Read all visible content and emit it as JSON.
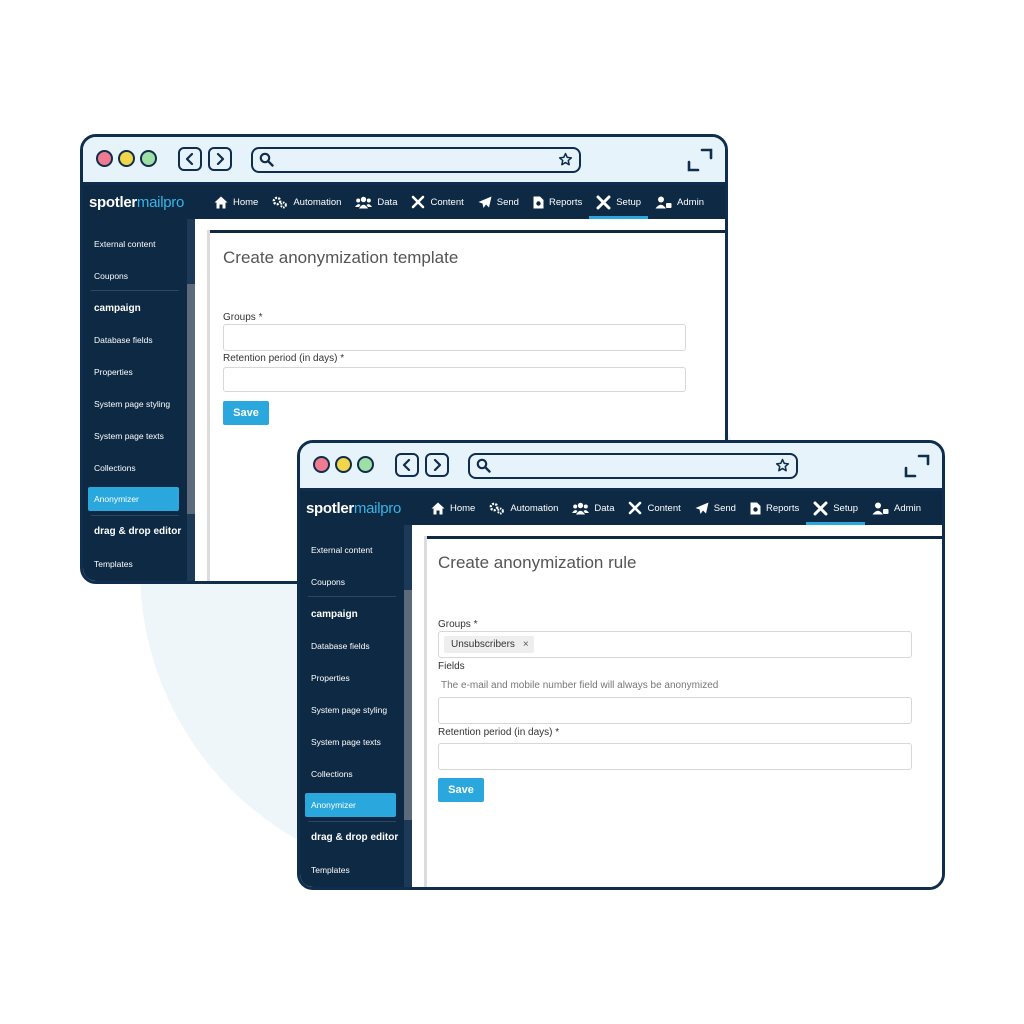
{
  "brand": {
    "name_main": "spotler",
    "name_accent": "mailpro",
    "accent_color": "#2aa8dd",
    "nav_bg": "#0d2944"
  },
  "nav": {
    "home": "Home",
    "automation": "Automation",
    "data": "Data",
    "content": "Content",
    "send": "Send",
    "reports": "Reports",
    "setup": "Setup",
    "admin": "Admin"
  },
  "sidebar": {
    "external_content": "External content",
    "coupons": "Coupons",
    "campaign": "campaign",
    "database_fields": "Database fields",
    "properties": "Properties",
    "system_page_styling": "System page styling",
    "system_page_texts": "System page texts",
    "collections": "Collections",
    "anonymizer": "Anonymizer",
    "drag_drop_editor": "drag & drop editor",
    "templates": "Templates"
  },
  "window1": {
    "title": "Create anonymization template",
    "groups_label": "Groups *",
    "retention_label": "Retention period (in days) *",
    "save_label": "Save"
  },
  "window2": {
    "title": "Create anonymization rule",
    "groups_label": "Groups *",
    "groups_tag": "Unsubscribers",
    "tag_remove": "×",
    "fields_label": "Fields",
    "fields_hint": "The e-mail and mobile number field will always be anonymized",
    "retention_label": "Retention period (in days) *",
    "save_label": "Save"
  }
}
